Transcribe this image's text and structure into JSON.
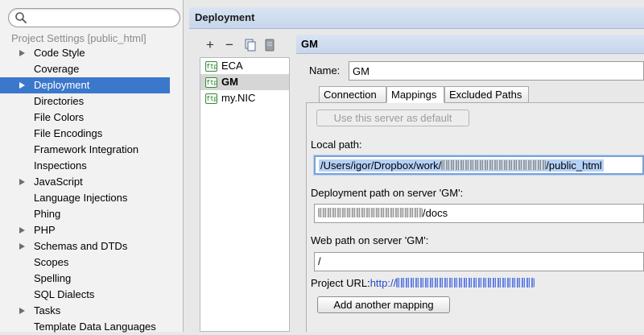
{
  "search": {
    "placeholder": "",
    "value": ""
  },
  "tree": {
    "title": "Project Settings [public_html]",
    "items": [
      {
        "label": "Code Style",
        "expandable": true,
        "selected": false
      },
      {
        "label": "Coverage",
        "expandable": false,
        "selected": false
      },
      {
        "label": "Deployment",
        "expandable": true,
        "selected": true
      },
      {
        "label": "Directories",
        "expandable": false,
        "selected": false
      },
      {
        "label": "File Colors",
        "expandable": false,
        "selected": false
      },
      {
        "label": "File Encodings",
        "expandable": false,
        "selected": false
      },
      {
        "label": "Framework Integration",
        "expandable": false,
        "selected": false
      },
      {
        "label": "Inspections",
        "expandable": false,
        "selected": false
      },
      {
        "label": "JavaScript",
        "expandable": true,
        "selected": false
      },
      {
        "label": "Language Injections",
        "expandable": false,
        "selected": false
      },
      {
        "label": "Phing",
        "expandable": false,
        "selected": false
      },
      {
        "label": "PHP",
        "expandable": true,
        "selected": false
      },
      {
        "label": "Schemas and DTDs",
        "expandable": true,
        "selected": false
      },
      {
        "label": "Scopes",
        "expandable": false,
        "selected": false
      },
      {
        "label": "Spelling",
        "expandable": false,
        "selected": false
      },
      {
        "label": "SQL Dialects",
        "expandable": false,
        "selected": false
      },
      {
        "label": "Tasks",
        "expandable": true,
        "selected": false
      },
      {
        "label": "Template Data Languages",
        "expandable": false,
        "selected": false
      }
    ]
  },
  "header": {
    "title": "Deployment"
  },
  "toolbar": {
    "add_label": "+",
    "remove_label": "−",
    "copy_icon": "copy-icon",
    "server_icon": "server-icon"
  },
  "servers": {
    "items": [
      {
        "label": "ECA",
        "icon": "ftp",
        "selected": false
      },
      {
        "label": "GM",
        "icon": "ftp",
        "selected": true
      },
      {
        "label": "my.NIC",
        "icon": "ftp",
        "selected": false
      }
    ]
  },
  "config": {
    "title": "GM",
    "name_label": "Name:",
    "name_value": "GM",
    "tabs": [
      {
        "label": "Connection",
        "active": false
      },
      {
        "label": "Mappings",
        "active": true
      },
      {
        "label": "Excluded Paths",
        "active": false
      }
    ],
    "default_button": "Use this server as default",
    "local_path_label": "Local path:",
    "local_path_prefix": "/Users/igor/Dropbox/work/",
    "local_path_suffix": "/public_html",
    "deployment_path_label": "Deployment path on server 'GM':",
    "deployment_path_suffix": "/docs",
    "web_path_label": "Web path on server 'GM':",
    "web_path_value": "/",
    "project_url_label": "Project URL:",
    "project_url_prefix": "http://",
    "add_mapping_button": "Add another mapping"
  },
  "colors": {
    "selection": "#3b78cc",
    "header_bg": "#c7d6ec",
    "link": "#2848c8",
    "ftp_icon": "#2e7d2e"
  }
}
